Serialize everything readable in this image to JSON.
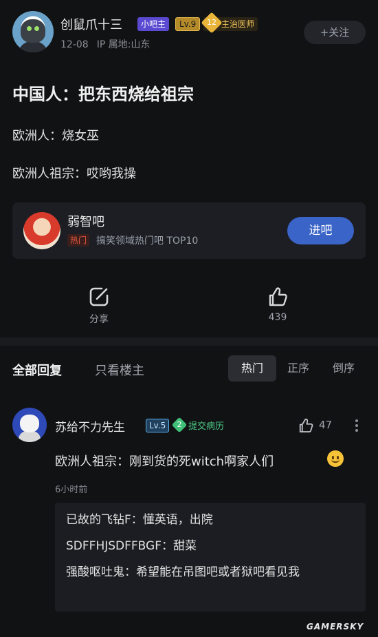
{
  "post": {
    "author": "创鼠爪十三",
    "badges": {
      "owner": "小吧主",
      "level": "Lv.9",
      "rank_number": "12",
      "rank_label": "主治医师"
    },
    "date": "12-08",
    "ip": "IP 属地:山东",
    "follow_label": "+关注",
    "title": "中国人：把东西烧给祖宗",
    "lines": [
      "欧洲人：烧女巫",
      "欧洲人祖宗：哎哟我操"
    ]
  },
  "forum": {
    "name": "弱智吧",
    "hot_tag": "热门",
    "description": "搞笑领域热门吧 TOP10",
    "enter_label": "进吧"
  },
  "actions": {
    "share_label": "分享",
    "like_count": "439"
  },
  "replies_bar": {
    "tab_all": "全部回复",
    "tab_op": "只看楼主",
    "sort": [
      "热门",
      "正序",
      "倒序"
    ]
  },
  "comment": {
    "author": "苏给不力先生",
    "level": "Lv.5",
    "rank_number": "2",
    "rank_label": "提交病历",
    "likes": "47",
    "text": "欧洲人祖宗：刚到货的死witch啊家人们",
    "time": "6小时前",
    "sub_replies": [
      {
        "author": "已故的飞钻F：",
        "text": "懂英语，出院"
      },
      {
        "author": "SDFFHJSDFFBGF：",
        "text": "甜菜"
      },
      {
        "author": "强酸呕吐鬼：",
        "text": "希望能在吊图吧或者狱吧看见我"
      }
    ]
  },
  "watermark": "GAMERSKY"
}
